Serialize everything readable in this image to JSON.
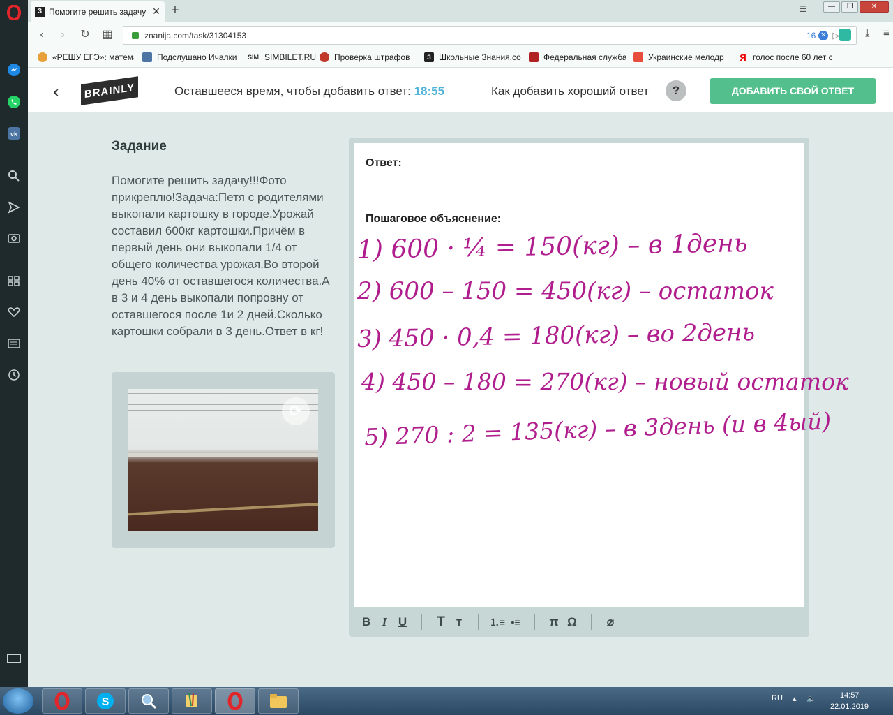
{
  "browser": {
    "tab_title": "Помогите решить задачу",
    "tab_favicon": "З",
    "url": "znanija.com/task/31304153",
    "adblock_count": "16",
    "bookmarks": [
      {
        "label": "«РЕШУ ЕГЭ»: матема",
        "color": "#e8a13a"
      },
      {
        "label": "Подслушано Ичалки",
        "color": "#4c75a3"
      },
      {
        "label": "SIMBILET.RU",
        "color": "#444444"
      },
      {
        "label": "Проверка штрафов",
        "color": "#c0392b"
      },
      {
        "label": "Школьные Знания.co",
        "color": "#222222"
      },
      {
        "label": "Федеральная служба",
        "color": "#b22222"
      },
      {
        "label": "Украинские мелодр",
        "color": "#e74c3c"
      },
      {
        "label": "голос после 60 лет с",
        "color": "#ffffff"
      }
    ],
    "bookmark_glyphs": [
      "",
      "",
      "SIM",
      "",
      "З",
      "",
      "",
      "Я"
    ]
  },
  "header": {
    "logo": "BRAINLY",
    "timer_label": "Оставшееся время, чтобы добавить ответ:",
    "timer_value": "18:55",
    "how_label": "Как добавить хороший ответ",
    "help_glyph": "?",
    "add_button": "ДОБАВИТЬ СВОЙ ОТВЕТ"
  },
  "task": {
    "heading": "Задание",
    "text": "Помогите решить задачу!!!Фото прикреплю!Задача:Петя с родителями выкопали картошку в городе.Урожай составил 600кг картошки.Причём в первый день они выкопали 1/4 от общего количества урожая.Во второй день 40% от оставшегося количества.А в 3 и 4 день выкопали попровну от оставшегося после 1и 2 дней.Сколько картошки собрали в 3 день.Ответ в кг!"
  },
  "answer": {
    "answer_label": "Ответ:",
    "explanation_label": "Пошаговое объяснение:",
    "steps": [
      "1)  600 · ¼ = 150(кг) – в 1день",
      "2)  600 – 150 = 450(кг) – остаток",
      "3)  450 · 0,4 = 180(кг) – во 2день",
      "4)  450 – 180 = 270(кг) – новый остаток",
      "5)  270 : 2 = 135(кг) – в 3день (и в 4ый)"
    ]
  },
  "toolbar": {
    "bold": "B",
    "italic": "I",
    "underline": "U",
    "text_big": "T",
    "text_small": "T",
    "ol": "⒈≡",
    "ul": "•≡",
    "pi": "π",
    "omega": "Ω",
    "attach": "⌀"
  },
  "taskbar": {
    "lang": "RU",
    "time": "14:57",
    "date": "22.01.2019"
  },
  "colors": {
    "accent_green": "#53bf8c",
    "timer_blue": "#4fb3d9",
    "handwriting": "#b01e8e"
  }
}
